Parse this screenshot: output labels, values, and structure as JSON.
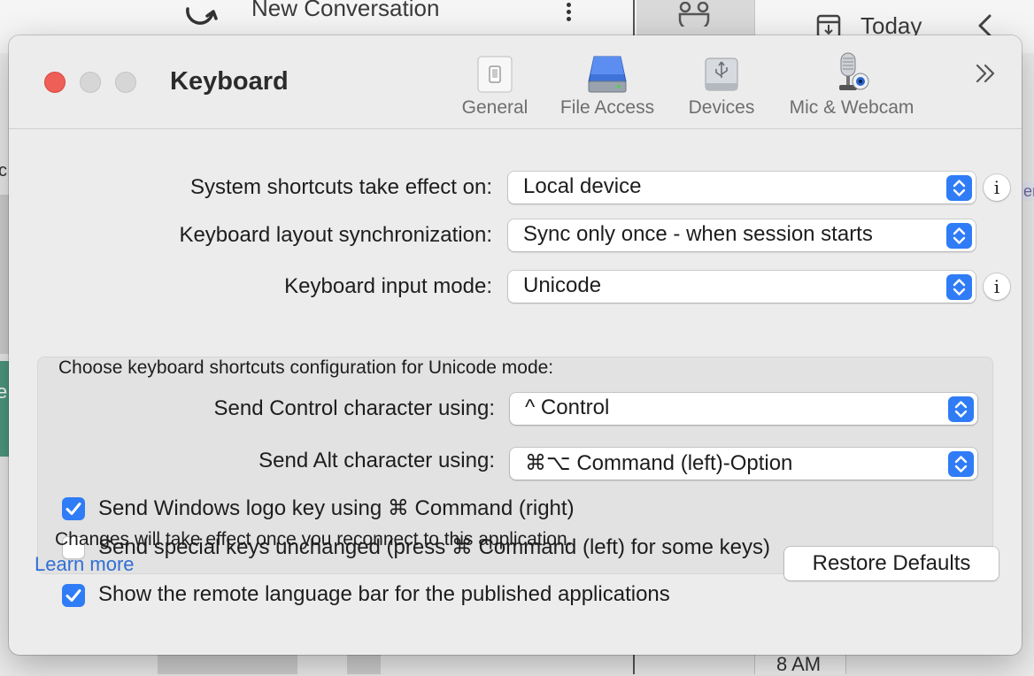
{
  "background": {
    "conversation_title": "New Conversation",
    "calendar_label": "Today",
    "time_label": "8 AM"
  },
  "window": {
    "title": "Keyboard",
    "toolbar": [
      {
        "label": "General",
        "icon": "switch-icon"
      },
      {
        "label": "File Access",
        "icon": "hard-drive-icon"
      },
      {
        "label": "Devices",
        "icon": "usb-drive-icon"
      },
      {
        "label": "Mic & Webcam",
        "icon": "microphone-webcam-icon"
      }
    ],
    "more_icon": "double-chevron-right-icon"
  },
  "settings": {
    "system_shortcuts": {
      "label": "System shortcuts take effect on:",
      "value": "Local device"
    },
    "layout_sync": {
      "label": "Keyboard layout synchronization:",
      "value": "Sync only once - when session starts"
    },
    "input_mode": {
      "label": "Keyboard input mode:",
      "value": "Unicode"
    }
  },
  "unicode_group": {
    "title": "Choose keyboard shortcuts configuration for Unicode mode:",
    "control": {
      "label": "Send Control character using:",
      "value": "^ Control"
    },
    "alt": {
      "label": "Send Alt character using:",
      "value": "⌘⌥ Command (left)-Option"
    },
    "windows_key": {
      "label": "Send Windows logo key using ⌘ Command (right)",
      "checked": true
    },
    "special_keys": {
      "label": "Send special keys unchanged (press ⌘ Command (left) for some keys)",
      "checked": false
    }
  },
  "language_bar": {
    "label": "Show the remote language bar for the published applications",
    "checked": true
  },
  "footer": {
    "note": "Changes will take effect once you reconnect to this application.",
    "learn_more": "Learn more",
    "restore_defaults": "Restore Defaults"
  },
  "colors": {
    "accent": "#2f7cf6",
    "close": "#ee5f57",
    "link": "#2f6fd6"
  }
}
